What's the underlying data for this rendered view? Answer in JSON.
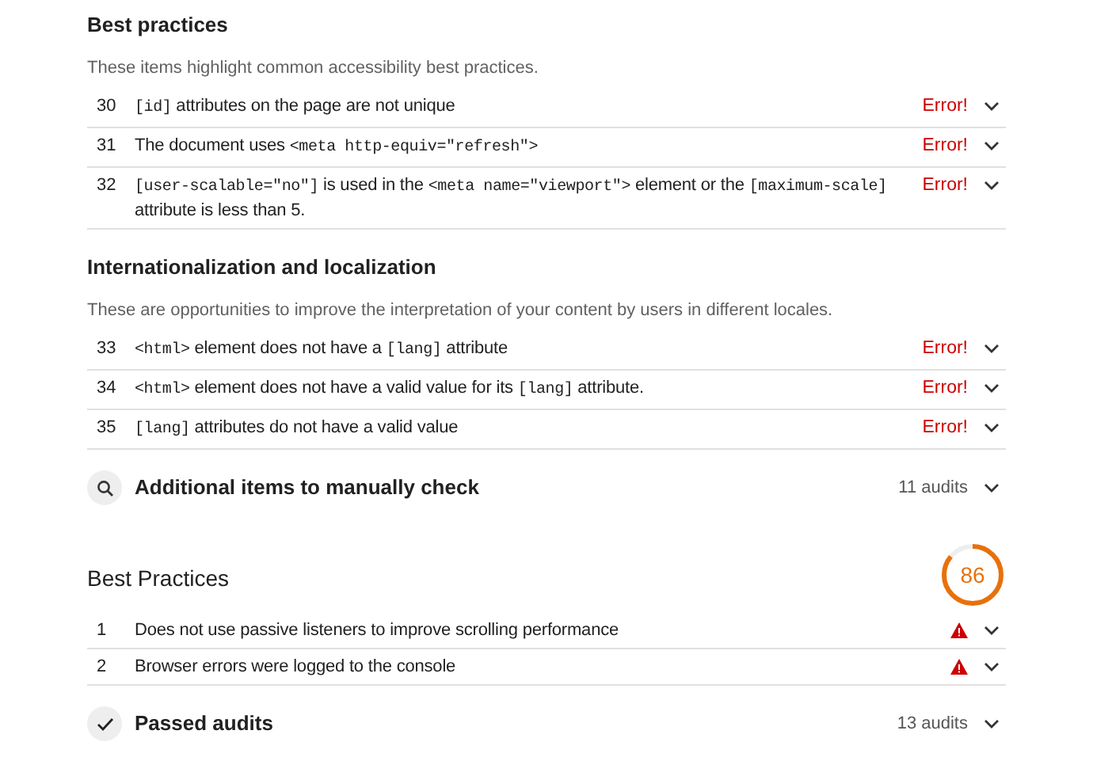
{
  "groups": [
    {
      "title": "Best practices",
      "description": "These items highlight common accessibility best practices.",
      "audits": [
        {
          "number": "30",
          "kind": "error",
          "status": "Error!",
          "text": [
            {
              "code": true,
              "s": "[id]"
            },
            {
              "code": false,
              "s": " attributes on the page are not unique"
            }
          ]
        },
        {
          "number": "31",
          "kind": "error",
          "status": "Error!",
          "text": [
            {
              "code": false,
              "s": "The document uses "
            },
            {
              "code": true,
              "s": "<meta http-equiv=\"refresh\">"
            }
          ]
        },
        {
          "number": "32",
          "kind": "error",
          "status": "Error!",
          "text": [
            {
              "code": true,
              "s": "[user-scalable=\"no\"]"
            },
            {
              "code": false,
              "s": " is used in the "
            },
            {
              "code": true,
              "s": "<meta name=\"viewport\">"
            },
            {
              "code": false,
              "s": " element or the "
            },
            {
              "code": true,
              "s": "[maximum-scale]"
            },
            {
              "code": false,
              "s": " attribute is less than 5."
            }
          ]
        }
      ]
    },
    {
      "title": "Internationalization and localization",
      "description": "These are opportunities to improve the interpretation of your content by users in different locales.",
      "audits": [
        {
          "number": "33",
          "kind": "error",
          "status": "Error!",
          "text": [
            {
              "code": true,
              "s": "<html>"
            },
            {
              "code": false,
              "s": " element does not have a "
            },
            {
              "code": true,
              "s": "[lang]"
            },
            {
              "code": false,
              "s": " attribute"
            }
          ]
        },
        {
          "number": "34",
          "kind": "error",
          "status": "Error!",
          "text": [
            {
              "code": true,
              "s": "<html>"
            },
            {
              "code": false,
              "s": " element does not have a valid value for its "
            },
            {
              "code": true,
              "s": "[lang]"
            },
            {
              "code": false,
              "s": " attribute."
            }
          ]
        },
        {
          "number": "35",
          "kind": "error",
          "status": "Error!",
          "text": [
            {
              "code": true,
              "s": "[lang]"
            },
            {
              "code": false,
              "s": " attributes do not have a valid value"
            }
          ]
        }
      ]
    }
  ],
  "manual_check": {
    "title": "Additional items to manually check",
    "count": "11 audits"
  },
  "category": {
    "title": "Best Practices",
    "score": "86",
    "level": 0.86,
    "audits": [
      {
        "number": "1",
        "kind": "warning",
        "text": [
          {
            "code": false,
            "s": "Does not use passive listeners to improve scrolling performance"
          }
        ]
      },
      {
        "number": "2",
        "kind": "warning",
        "text": [
          {
            "code": false,
            "s": "Browser errors were logged to the console"
          }
        ]
      }
    ]
  },
  "passed": {
    "title": "Passed audits",
    "count": "13 audits"
  }
}
